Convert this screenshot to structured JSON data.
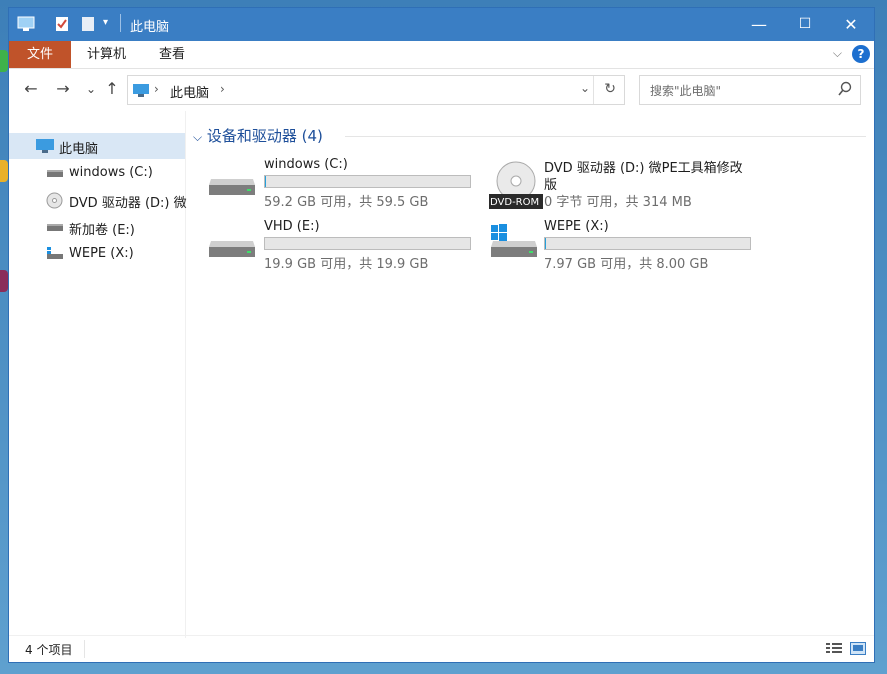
{
  "window": {
    "title": "此电脑",
    "controls": {
      "minimize": "—",
      "maximize": "☐",
      "close": "✕"
    }
  },
  "ribbon": {
    "tabs": [
      "文件",
      "计算机",
      "查看"
    ],
    "help": "?",
    "collapse": "⌵"
  },
  "nav": {
    "back": "←",
    "forward": "→",
    "recent": "⌄",
    "up": "↑",
    "address": "此电脑",
    "address_sep": "›",
    "dropdown": "⌄",
    "refresh": "↻",
    "search_placeholder": "搜索\"此电脑\""
  },
  "sidebar": {
    "items": [
      {
        "label": "此电脑",
        "icon": "computer-icon"
      },
      {
        "label": "windows (C:)",
        "icon": "drive-icon"
      },
      {
        "label": "DVD 驱动器 (D:) 微",
        "icon": "dvd-icon"
      },
      {
        "label": "新加卷 (E:)",
        "icon": "drive-icon"
      },
      {
        "label": "WEPE (X:)",
        "icon": "network-drive-icon"
      }
    ]
  },
  "content": {
    "group_title": "设备和驱动器 (4)",
    "drives": [
      {
        "name": "windows (C:)",
        "info": "59.2 GB 可用，共 59.5 GB",
        "used_fraction": 0.005,
        "icon": "hdd-icon"
      },
      {
        "name": "DVD 驱动器 (D:) 微PE工具箱修改",
        "name2": "版",
        "info": "0 字节 可用，共 314 MB",
        "icon": "dvd-rom-icon",
        "badge": "DVD-ROM"
      },
      {
        "name": "VHD (E:)",
        "info": "19.9 GB 可用，共 19.9 GB",
        "used_fraction": 0.0,
        "icon": "hdd-icon"
      },
      {
        "name": "WEPE (X:)",
        "info": "7.97 GB 可用，共 8.00 GB",
        "used_fraction": 0.004,
        "icon": "windows-drive-icon"
      }
    ]
  },
  "status": {
    "count": "4 个项目"
  },
  "colors": {
    "accent": "#3a7ec4",
    "file_tab": "#c0532a",
    "group_header": "#1e4f9a",
    "bar": "#26a0da"
  }
}
